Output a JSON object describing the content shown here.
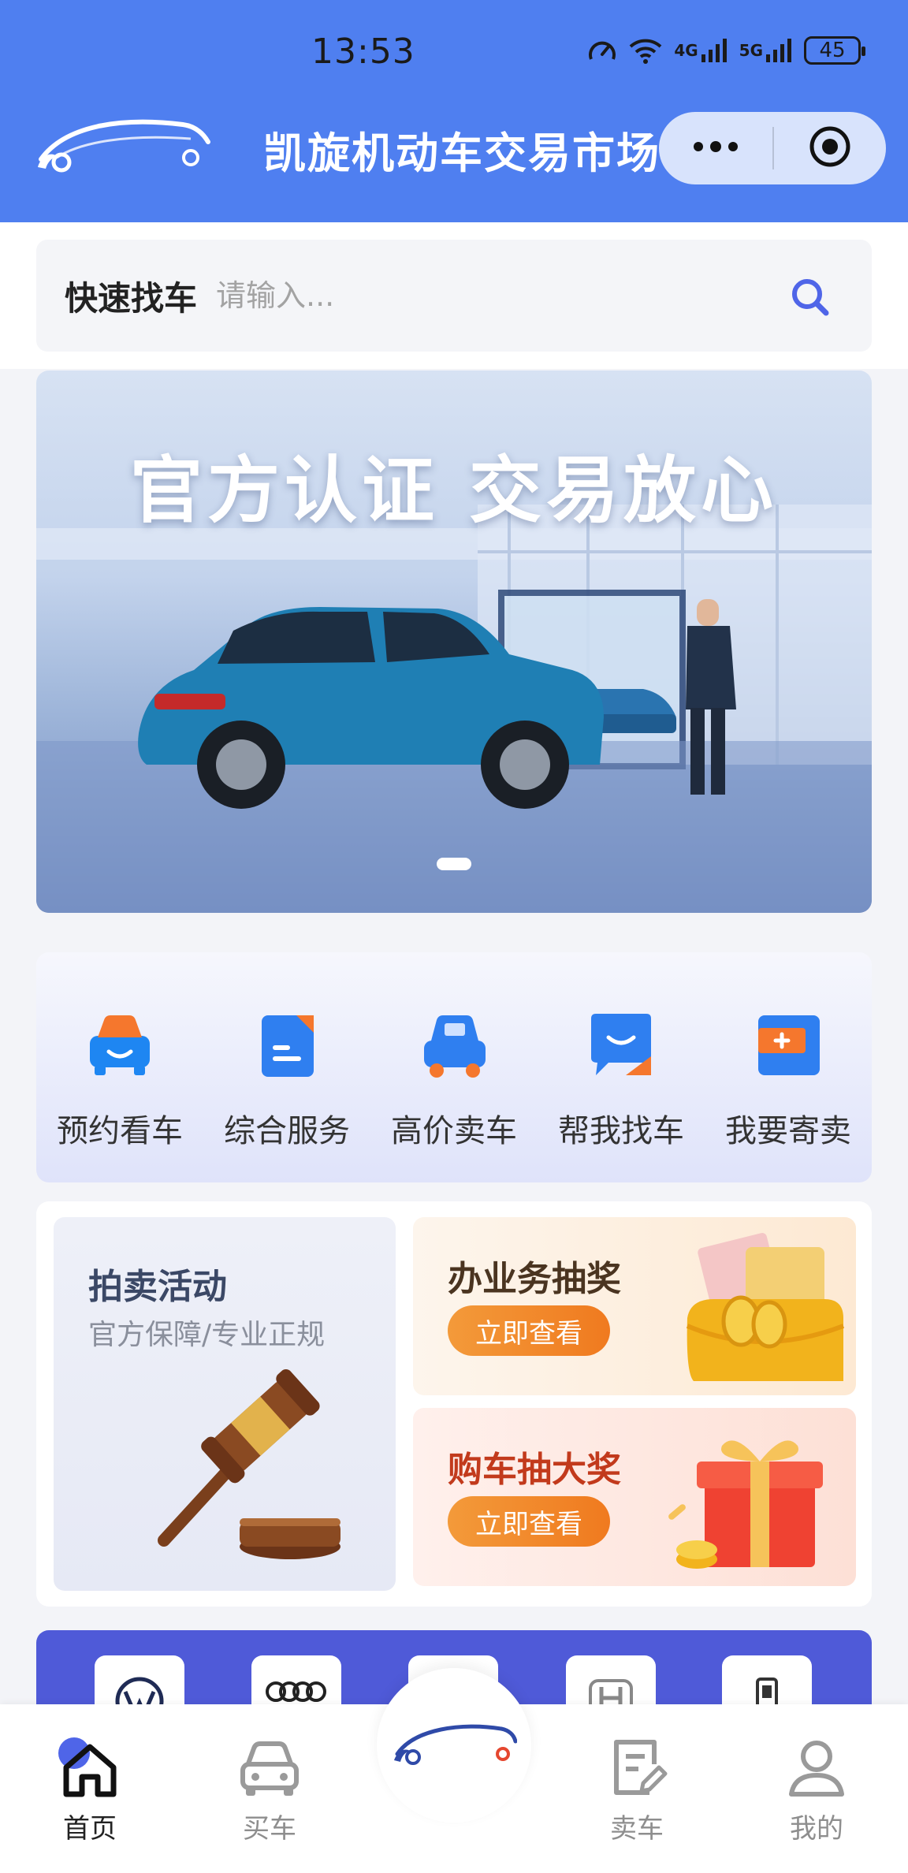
{
  "status_bar": {
    "time": "13:53",
    "network_4g": "4G",
    "network_5g": "5G",
    "battery": "45"
  },
  "app": {
    "title": "凯旋机动车交易市场",
    "logo_text": "凯旋机动车交易市场"
  },
  "capsule": {
    "more_icon": "more-dots-icon",
    "close_icon": "target-close-icon"
  },
  "search": {
    "label": "快速找车",
    "placeholder": "请输入..."
  },
  "banner": {
    "headline": "官方认证  交易放心",
    "slides": 1,
    "active_slide": 1
  },
  "services": [
    {
      "label": "预约看车",
      "icon": "car-appointment-icon",
      "color": "#f5772d"
    },
    {
      "label": "综合服务",
      "icon": "document-service-icon",
      "color": "#2f7ff0"
    },
    {
      "label": "高价卖车",
      "icon": "car-sell-icon",
      "color": "#2f7ff0"
    },
    {
      "label": "帮我找车",
      "icon": "chat-find-icon",
      "color": "#2f7ff0"
    },
    {
      "label": "我要寄卖",
      "icon": "consign-icon",
      "color": "#2f7ff0"
    }
  ],
  "promo": {
    "auction": {
      "title": "拍卖活动",
      "subtitle": "官方保障/专业正规"
    },
    "lottery_business": {
      "title": "办业务抽奖",
      "button": "立即查看"
    },
    "lottery_purchase": {
      "title": "购车抽大奖",
      "button": "立即查看"
    }
  },
  "brands": [
    "volkswagen-logo-icon",
    "audi-logo-icon",
    "brand-logo-icon",
    "honda-logo-icon",
    "brand-logo-icon"
  ],
  "tabbar": {
    "items": [
      {
        "label": "首页",
        "icon": "home-icon",
        "active": true
      },
      {
        "label": "买车",
        "icon": "car-icon",
        "active": false
      },
      {
        "label": "",
        "icon": "app-logo-icon",
        "active": false
      },
      {
        "label": "卖车",
        "icon": "edit-document-icon",
        "active": false
      },
      {
        "label": "我的",
        "icon": "user-icon",
        "active": false
      }
    ]
  },
  "colors": {
    "header": "#4f7ff0",
    "accent_orange": "#f07a1f",
    "brand_strip": "#4f5ad8"
  }
}
